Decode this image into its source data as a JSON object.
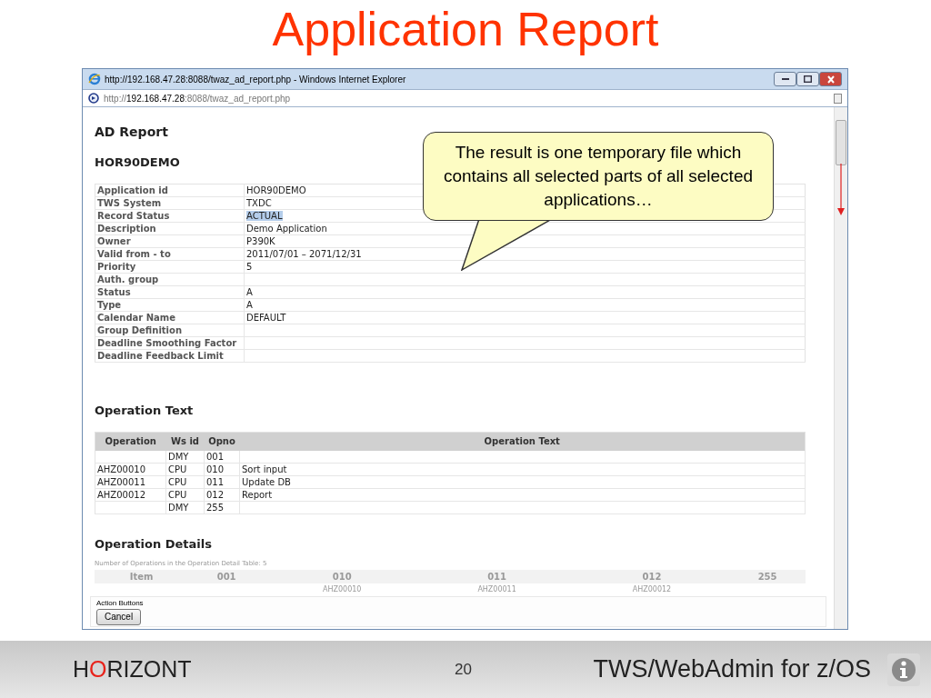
{
  "slide_title": "Application Report",
  "browser": {
    "title": "http://192.168.47.28:8088/twaz_ad_report.php - Windows Internet Explorer",
    "address": {
      "prefix": "http://",
      "host": "192.168.47.28",
      "rest": ":8088/twaz_ad_report.php"
    }
  },
  "report": {
    "title": "AD Report",
    "application": "HOR90DEMO",
    "fields": [
      {
        "label": "Application id",
        "value": "HOR90DEMO",
        "highlighted": false
      },
      {
        "label": "TWS System",
        "value": "TXDC",
        "highlighted": false
      },
      {
        "label": "Record Status",
        "value": "ACTUAL",
        "highlighted": true
      },
      {
        "label": "Description",
        "value": "Demo Application",
        "highlighted": false
      },
      {
        "label": "Owner",
        "value": "P390K",
        "highlighted": false
      },
      {
        "label": "Valid from - to",
        "value": "2011/07/01 – 2071/12/31",
        "highlighted": false
      },
      {
        "label": "Priority",
        "value": "5",
        "highlighted": false
      },
      {
        "label": "Auth. group",
        "highlighted": false
      },
      {
        "label": "Status",
        "value": "A",
        "highlighted": false
      },
      {
        "label": "Type",
        "value": "A",
        "highlighted": false
      },
      {
        "label": "Calendar Name",
        "value": "DEFAULT",
        "highlighted": false
      },
      {
        "label": "Group Definition",
        "highlighted": false
      },
      {
        "label": "Deadline Smoothing Factor",
        "highlighted": false
      },
      {
        "label": "Deadline Feedback Limit",
        "highlighted": false
      }
    ],
    "operation_text": {
      "heading": "Operation Text",
      "columns": [
        "Operation",
        "Ws id",
        "Opno",
        "Operation Text"
      ],
      "rows": [
        [
          "",
          "DMY",
          "001",
          ""
        ],
        [
          "AHZ00010",
          "CPU",
          "010",
          "Sort input"
        ],
        [
          "AHZ00011",
          "CPU",
          "011",
          "Update DB"
        ],
        [
          "AHZ00012",
          "CPU",
          "012",
          "Report"
        ],
        [
          "",
          "DMY",
          "255",
          ""
        ]
      ]
    },
    "operation_details": {
      "heading": "Operation Details",
      "note": "Number of Operations in the Operation Detail Table: 5",
      "columns": [
        {
          "label": "Item"
        },
        {
          "label": "001"
        },
        {
          "label": "010",
          "job": "AHZ00010"
        },
        {
          "label": "011",
          "job": "AHZ00011"
        },
        {
          "label": "012",
          "job": "AHZ00012"
        },
        {
          "label": "255"
        }
      ]
    }
  },
  "action_bar": {
    "label": "Action Buttons",
    "buttons": [
      "Cancel"
    ]
  },
  "callout": "The result is one temporary file which contains all selected parts of all selected applications…",
  "footer": {
    "logo": [
      {
        "text": "H",
        "accent": false
      },
      {
        "text": "O",
        "accent": true
      },
      {
        "text": "RIZONT",
        "accent": false
      }
    ],
    "page": "20",
    "product": "TWS/WebAdmin for z/OS"
  }
}
